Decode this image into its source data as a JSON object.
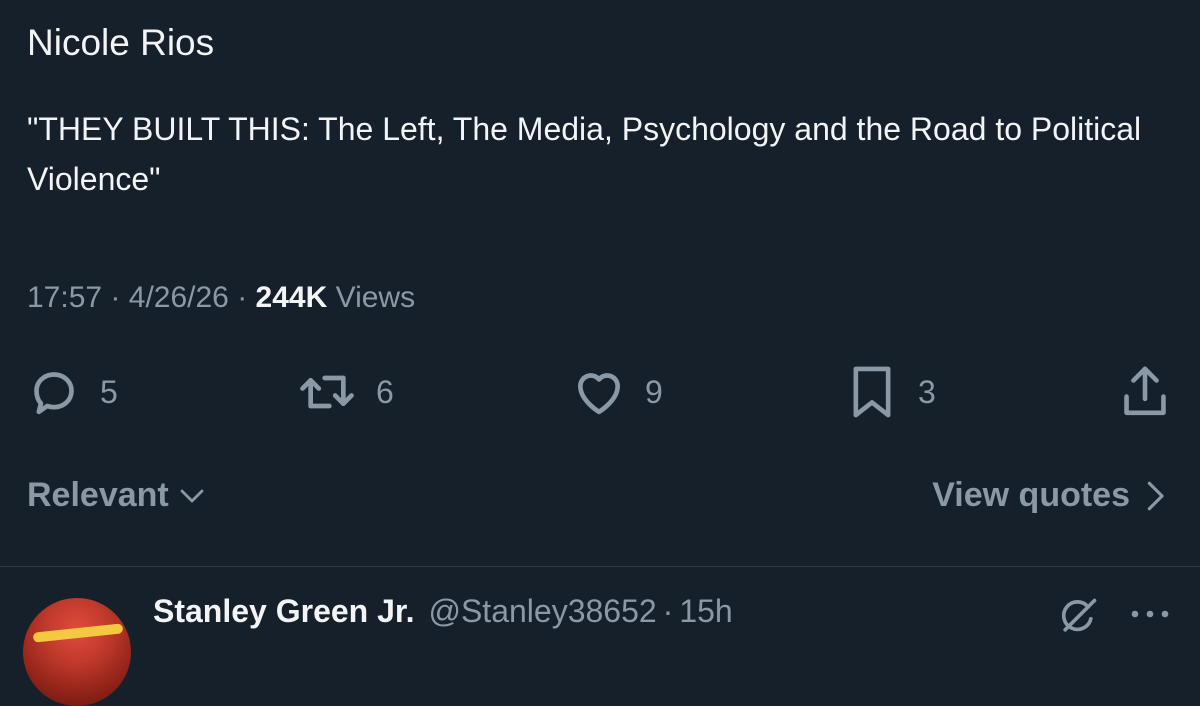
{
  "tweet": {
    "author": "Nicole Rios",
    "text": "\"THEY BUILT THIS: The Left, The Media, Psychology and the Road to Political Violence\"",
    "time": "17:57",
    "date": "4/26/26",
    "views_count": "244K",
    "views_label": "Views",
    "separator": "·"
  },
  "actions": {
    "replies": "5",
    "reposts": "6",
    "likes": "9",
    "bookmarks": "3"
  },
  "sort": {
    "label": "Relevant",
    "view_quotes_label": "View quotes"
  },
  "reply": {
    "name": "Stanley Green Jr.",
    "handle": "@Stanley38652",
    "separator": "·",
    "time": "15h"
  },
  "icons": {
    "reply": "comment-bubble-icon",
    "repost": "repost-icon",
    "like": "heart-icon",
    "bookmark": "bookmark-icon",
    "share": "share-icon",
    "sort": "chevron-down-icon",
    "view_quotes": "chevron-right-icon",
    "grok": "grok-icon",
    "more": "more-icon"
  },
  "colors": {
    "background": "#15202b",
    "primary_text": "#f2f4f5",
    "secondary_text": "#8b98a5",
    "divider": "#2f3b47"
  }
}
